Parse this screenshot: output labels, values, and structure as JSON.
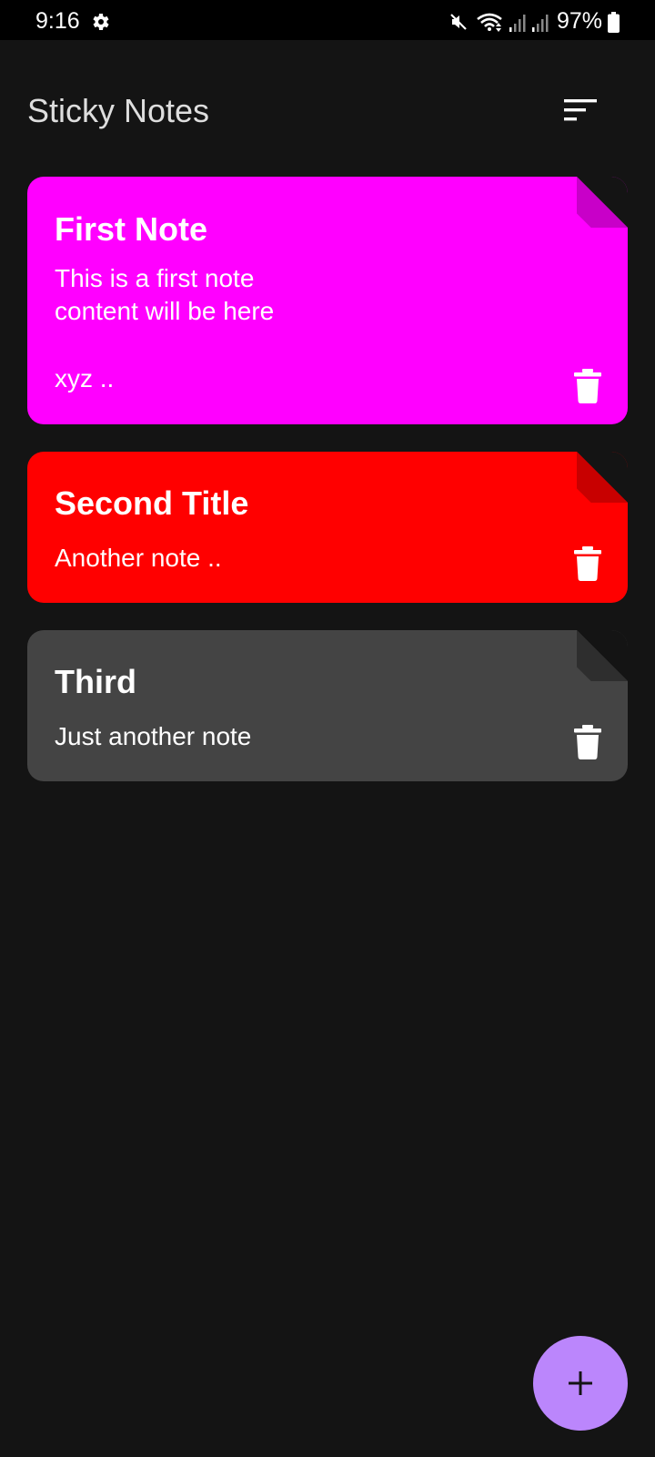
{
  "status_bar": {
    "time": "9:16",
    "battery": "97%",
    "icons": [
      "settings-gear-icon",
      "mute-icon",
      "wifi-icon",
      "signal-icon",
      "signal-icon",
      "battery-icon"
    ]
  },
  "header": {
    "title": "Sticky Notes",
    "sort_icon": "sort-icon"
  },
  "notes": [
    {
      "title": "First Note",
      "body": "This is a first note\ncontent will be here",
      "extra": "xyz ..",
      "color": "#ff00ff"
    },
    {
      "title": "Second Title",
      "body": "Another note ..",
      "color": "#ff0000"
    },
    {
      "title": "Third",
      "body": "Just another note",
      "color": "#444444"
    }
  ],
  "fab": {
    "icon": "plus-icon",
    "color": "#bb86fc"
  },
  "theme": {
    "background": "#141414",
    "title_color": "#dedede"
  }
}
